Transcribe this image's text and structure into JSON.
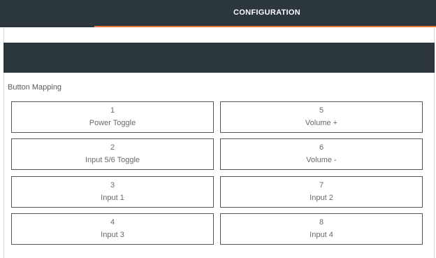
{
  "header": {
    "title": "CONFIGURATION"
  },
  "accent_color": "#e07a3f",
  "dark_color": "#2b363d",
  "section": {
    "label": "Button Mapping"
  },
  "buttons": [
    {
      "number": "1",
      "label": "Power Toggle"
    },
    {
      "number": "2",
      "label": "Input 5/6 Toggle"
    },
    {
      "number": "3",
      "label": "Input 1"
    },
    {
      "number": "4",
      "label": "Input 3"
    },
    {
      "number": "5",
      "label": "Volume +"
    },
    {
      "number": "6",
      "label": "Volume -"
    },
    {
      "number": "7",
      "label": "Input 2"
    },
    {
      "number": "8",
      "label": "Input 4"
    }
  ]
}
